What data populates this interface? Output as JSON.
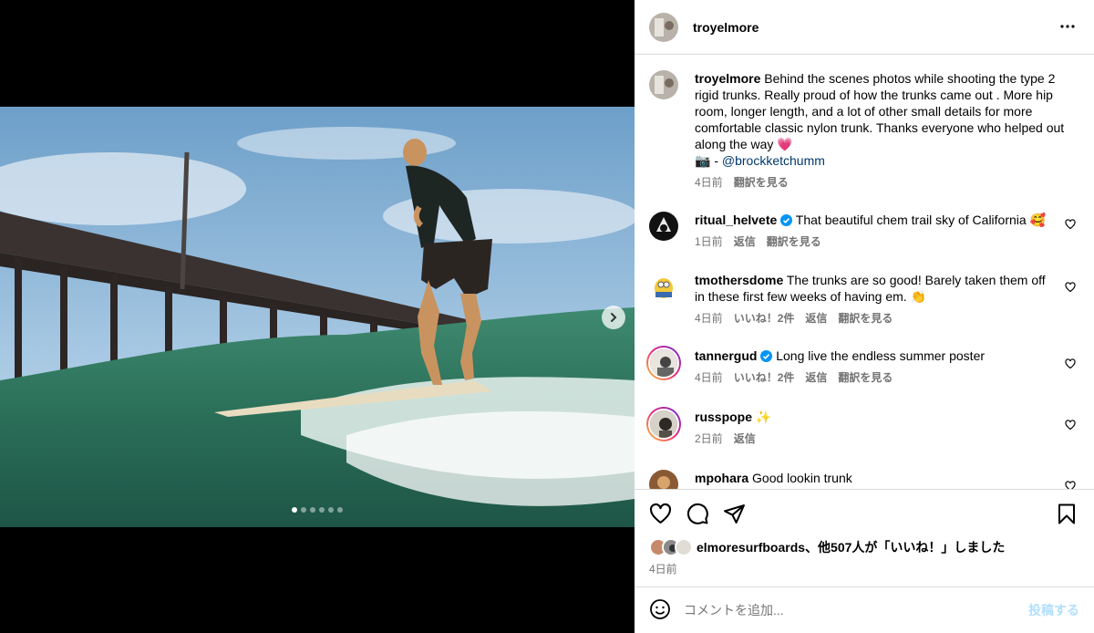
{
  "post": {
    "author": "troyelmore",
    "caption": "Behind the scenes photos while shooting the type 2 rigid trunks. Really proud of how the trunks came out . More hip room, longer length, and a lot of other small details for more comfortable classic nylon trunk. Thanks everyone who helped out along the way 💗",
    "credit_prefix": "📷 - ",
    "credit_mention": "@brockketchumm",
    "caption_time": "4日前",
    "caption_translate": "翻訳を見る",
    "more_icon": "more-horizontal-icon",
    "carousel": {
      "total": 6,
      "active": 1
    }
  },
  "comments": [
    {
      "user": "ritual_helvete",
      "verified": true,
      "text": "That beautiful chem trail sky of California 🥰",
      "time": "1日前",
      "likes": "",
      "reply": "返信",
      "translate": "翻訳を見る"
    },
    {
      "user": "tmothersdome",
      "verified": false,
      "text": "The trunks are so good! Barely taken them off in these first few weeks of having em. 👏",
      "time": "4日前",
      "likes": "いいね！2件",
      "reply": "返信",
      "translate": "翻訳を見る"
    },
    {
      "user": "tannergud",
      "verified": true,
      "text": "Long live the endless summer poster",
      "time": "4日前",
      "likes": "いいね！2件",
      "reply": "返信",
      "translate": "翻訳を見る"
    },
    {
      "user": "russpope",
      "verified": false,
      "text": "✨",
      "time": "2日前",
      "likes": "",
      "reply": "返信",
      "translate": ""
    },
    {
      "user": "mpohara",
      "verified": false,
      "text": "Good lookin trunk",
      "time": "",
      "likes": "",
      "reply": "",
      "translate": ""
    }
  ],
  "likes": {
    "users": "elmoresurfboards",
    "summary": "、他507人が「いいね！」しました"
  },
  "post_date": "4日前",
  "comment_box": {
    "placeholder": "コメントを追加...",
    "post_label": "投稿する"
  },
  "colors": {
    "accent": "#0095f6",
    "post_disabled": "#b2dffc",
    "muted": "#737373"
  }
}
